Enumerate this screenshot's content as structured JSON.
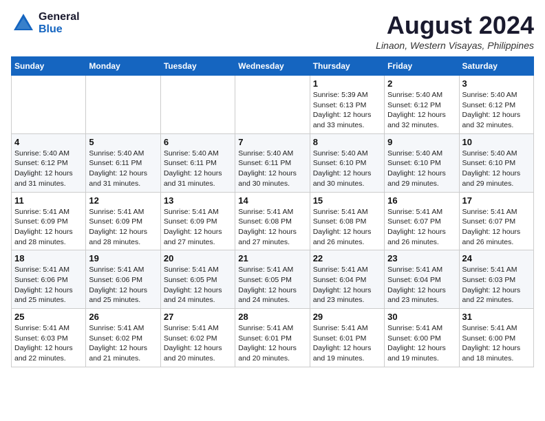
{
  "header": {
    "logo_general": "General",
    "logo_blue": "Blue",
    "month_title": "August 2024",
    "location": "Linaon, Western Visayas, Philippines"
  },
  "days_of_week": [
    "Sunday",
    "Monday",
    "Tuesday",
    "Wednesday",
    "Thursday",
    "Friday",
    "Saturday"
  ],
  "weeks": [
    [
      {
        "day": "",
        "content": ""
      },
      {
        "day": "",
        "content": ""
      },
      {
        "day": "",
        "content": ""
      },
      {
        "day": "",
        "content": ""
      },
      {
        "day": "1",
        "content": "Sunrise: 5:39 AM\nSunset: 6:13 PM\nDaylight: 12 hours\nand 33 minutes."
      },
      {
        "day": "2",
        "content": "Sunrise: 5:40 AM\nSunset: 6:12 PM\nDaylight: 12 hours\nand 32 minutes."
      },
      {
        "day": "3",
        "content": "Sunrise: 5:40 AM\nSunset: 6:12 PM\nDaylight: 12 hours\nand 32 minutes."
      }
    ],
    [
      {
        "day": "4",
        "content": "Sunrise: 5:40 AM\nSunset: 6:12 PM\nDaylight: 12 hours\nand 31 minutes."
      },
      {
        "day": "5",
        "content": "Sunrise: 5:40 AM\nSunset: 6:11 PM\nDaylight: 12 hours\nand 31 minutes."
      },
      {
        "day": "6",
        "content": "Sunrise: 5:40 AM\nSunset: 6:11 PM\nDaylight: 12 hours\nand 31 minutes."
      },
      {
        "day": "7",
        "content": "Sunrise: 5:40 AM\nSunset: 6:11 PM\nDaylight: 12 hours\nand 30 minutes."
      },
      {
        "day": "8",
        "content": "Sunrise: 5:40 AM\nSunset: 6:10 PM\nDaylight: 12 hours\nand 30 minutes."
      },
      {
        "day": "9",
        "content": "Sunrise: 5:40 AM\nSunset: 6:10 PM\nDaylight: 12 hours\nand 29 minutes."
      },
      {
        "day": "10",
        "content": "Sunrise: 5:40 AM\nSunset: 6:10 PM\nDaylight: 12 hours\nand 29 minutes."
      }
    ],
    [
      {
        "day": "11",
        "content": "Sunrise: 5:41 AM\nSunset: 6:09 PM\nDaylight: 12 hours\nand 28 minutes."
      },
      {
        "day": "12",
        "content": "Sunrise: 5:41 AM\nSunset: 6:09 PM\nDaylight: 12 hours\nand 28 minutes."
      },
      {
        "day": "13",
        "content": "Sunrise: 5:41 AM\nSunset: 6:09 PM\nDaylight: 12 hours\nand 27 minutes."
      },
      {
        "day": "14",
        "content": "Sunrise: 5:41 AM\nSunset: 6:08 PM\nDaylight: 12 hours\nand 27 minutes."
      },
      {
        "day": "15",
        "content": "Sunrise: 5:41 AM\nSunset: 6:08 PM\nDaylight: 12 hours\nand 26 minutes."
      },
      {
        "day": "16",
        "content": "Sunrise: 5:41 AM\nSunset: 6:07 PM\nDaylight: 12 hours\nand 26 minutes."
      },
      {
        "day": "17",
        "content": "Sunrise: 5:41 AM\nSunset: 6:07 PM\nDaylight: 12 hours\nand 26 minutes."
      }
    ],
    [
      {
        "day": "18",
        "content": "Sunrise: 5:41 AM\nSunset: 6:06 PM\nDaylight: 12 hours\nand 25 minutes."
      },
      {
        "day": "19",
        "content": "Sunrise: 5:41 AM\nSunset: 6:06 PM\nDaylight: 12 hours\nand 25 minutes."
      },
      {
        "day": "20",
        "content": "Sunrise: 5:41 AM\nSunset: 6:05 PM\nDaylight: 12 hours\nand 24 minutes."
      },
      {
        "day": "21",
        "content": "Sunrise: 5:41 AM\nSunset: 6:05 PM\nDaylight: 12 hours\nand 24 minutes."
      },
      {
        "day": "22",
        "content": "Sunrise: 5:41 AM\nSunset: 6:04 PM\nDaylight: 12 hours\nand 23 minutes."
      },
      {
        "day": "23",
        "content": "Sunrise: 5:41 AM\nSunset: 6:04 PM\nDaylight: 12 hours\nand 23 minutes."
      },
      {
        "day": "24",
        "content": "Sunrise: 5:41 AM\nSunset: 6:03 PM\nDaylight: 12 hours\nand 22 minutes."
      }
    ],
    [
      {
        "day": "25",
        "content": "Sunrise: 5:41 AM\nSunset: 6:03 PM\nDaylight: 12 hours\nand 22 minutes."
      },
      {
        "day": "26",
        "content": "Sunrise: 5:41 AM\nSunset: 6:02 PM\nDaylight: 12 hours\nand 21 minutes."
      },
      {
        "day": "27",
        "content": "Sunrise: 5:41 AM\nSunset: 6:02 PM\nDaylight: 12 hours\nand 20 minutes."
      },
      {
        "day": "28",
        "content": "Sunrise: 5:41 AM\nSunset: 6:01 PM\nDaylight: 12 hours\nand 20 minutes."
      },
      {
        "day": "29",
        "content": "Sunrise: 5:41 AM\nSunset: 6:01 PM\nDaylight: 12 hours\nand 19 minutes."
      },
      {
        "day": "30",
        "content": "Sunrise: 5:41 AM\nSunset: 6:00 PM\nDaylight: 12 hours\nand 19 minutes."
      },
      {
        "day": "31",
        "content": "Sunrise: 5:41 AM\nSunset: 6:00 PM\nDaylight: 12 hours\nand 18 minutes."
      }
    ]
  ]
}
